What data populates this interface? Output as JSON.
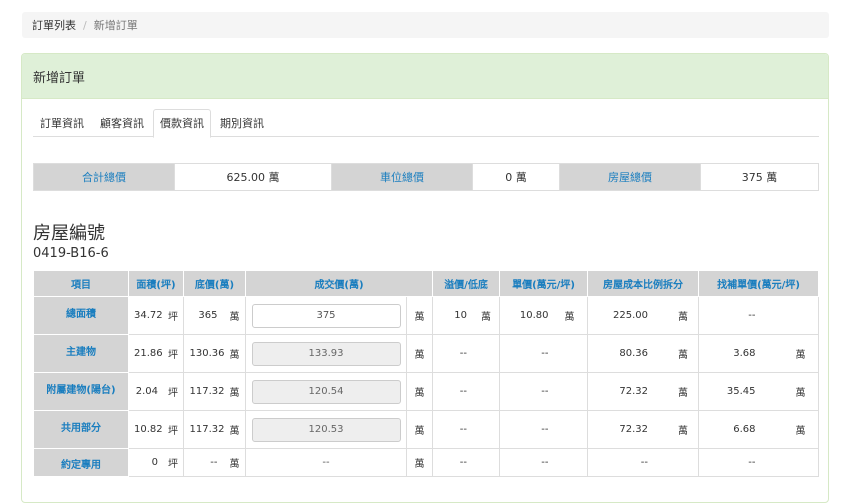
{
  "breadcrumb": {
    "items": [
      "訂單列表",
      "新增訂單"
    ]
  },
  "panel": {
    "title": "新增訂單"
  },
  "tabs": [
    {
      "label": "訂單資訊",
      "active": false
    },
    {
      "label": "顧客資訊",
      "active": false
    },
    {
      "label": "價款資訊",
      "active": true
    },
    {
      "label": "期別資訊",
      "active": false
    }
  ],
  "summary": {
    "total_label": "合計總價",
    "total_value": "625.00 萬",
    "parking_label": "車位總價",
    "parking_value": "0 萬",
    "house_label": "房屋總價",
    "house_value": "375 萬"
  },
  "house": {
    "title": "房屋編號",
    "number": "0419-B16-6"
  },
  "table": {
    "headers": [
      "項目",
      "面積(坪)",
      "底價(萬)",
      "成交價(萬)",
      "溢價/低底",
      "單價(萬元/坪)",
      "房屋成本比例拆分",
      "找補單價(萬元/坪)"
    ],
    "area_unit": "坪",
    "money_unit": "萬",
    "rows": [
      {
        "item": "總面積",
        "area": "34.72",
        "base": "365",
        "deal": "375",
        "deal_readonly": false,
        "premium": "10",
        "premium_unit": "萬",
        "unit_price": "10.80",
        "unit_price_unit": "萬",
        "cost": "225.00",
        "cost_unit": "萬",
        "adjust": "--",
        "adjust_unit": ""
      },
      {
        "item": "主建物",
        "area": "21.86",
        "base": "130.36",
        "deal": "133.93",
        "deal_readonly": true,
        "premium": "--",
        "premium_unit": "",
        "unit_price": "--",
        "unit_price_unit": "",
        "cost": "80.36",
        "cost_unit": "萬",
        "adjust": "3.68",
        "adjust_unit": "萬"
      },
      {
        "item": "附屬建物(陽台)",
        "area": "2.04",
        "base": "117.32",
        "deal": "120.54",
        "deal_readonly": true,
        "premium": "--",
        "premium_unit": "",
        "unit_price": "--",
        "unit_price_unit": "",
        "cost": "72.32",
        "cost_unit": "萬",
        "adjust": "35.45",
        "adjust_unit": "萬"
      },
      {
        "item": "共用部分",
        "area": "10.82",
        "base": "117.32",
        "deal": "120.53",
        "deal_readonly": true,
        "premium": "--",
        "premium_unit": "",
        "unit_price": "--",
        "unit_price_unit": "",
        "cost": "72.32",
        "cost_unit": "萬",
        "adjust": "6.68",
        "adjust_unit": "萬"
      },
      {
        "item": "約定專用",
        "area": "0",
        "base": "--",
        "deal": "--",
        "deal_readonly": null,
        "premium": "--",
        "premium_unit": "",
        "unit_price": "--",
        "unit_price_unit": "",
        "cost": "--",
        "cost_unit": "",
        "adjust": "--",
        "adjust_unit": ""
      }
    ]
  }
}
